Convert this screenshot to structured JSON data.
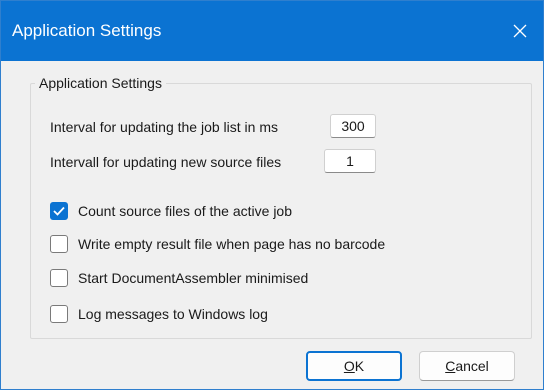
{
  "window": {
    "title": "Application Settings",
    "accent_color": "#0b73d2"
  },
  "group": {
    "caption": "Application Settings"
  },
  "fields": {
    "job_interval_label": "Interval for updating the job list in ms",
    "job_interval_value": "300",
    "source_interval_label": "Intervall for updating new source files",
    "source_interval_value": "1"
  },
  "options": [
    {
      "label": "Count source files of the active job",
      "checked": true
    },
    {
      "label": "Write empty result file when page has no barcode",
      "checked": false
    },
    {
      "label": "Start DocumentAssembler minimised",
      "checked": false
    },
    {
      "label": "Log messages to Windows log",
      "checked": false
    }
  ],
  "buttons": {
    "ok_mnemonic": "O",
    "ok_rest": "K",
    "cancel_mnemonic": "C",
    "cancel_rest": "ancel"
  },
  "icons": {
    "close": "close-icon",
    "check": "checkmark-icon"
  }
}
